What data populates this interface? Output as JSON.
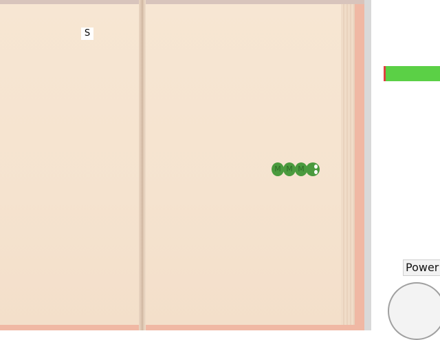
{
  "board": {
    "start_marker": "S",
    "snake": {
      "segment_label": "M",
      "segment_count": 3,
      "color": "#4a9a3e"
    }
  },
  "health_bar": {
    "level": 0.96,
    "fill_color": "#5bd046",
    "empty_color": "#e04040"
  },
  "controls": {
    "power_label": "Power"
  }
}
